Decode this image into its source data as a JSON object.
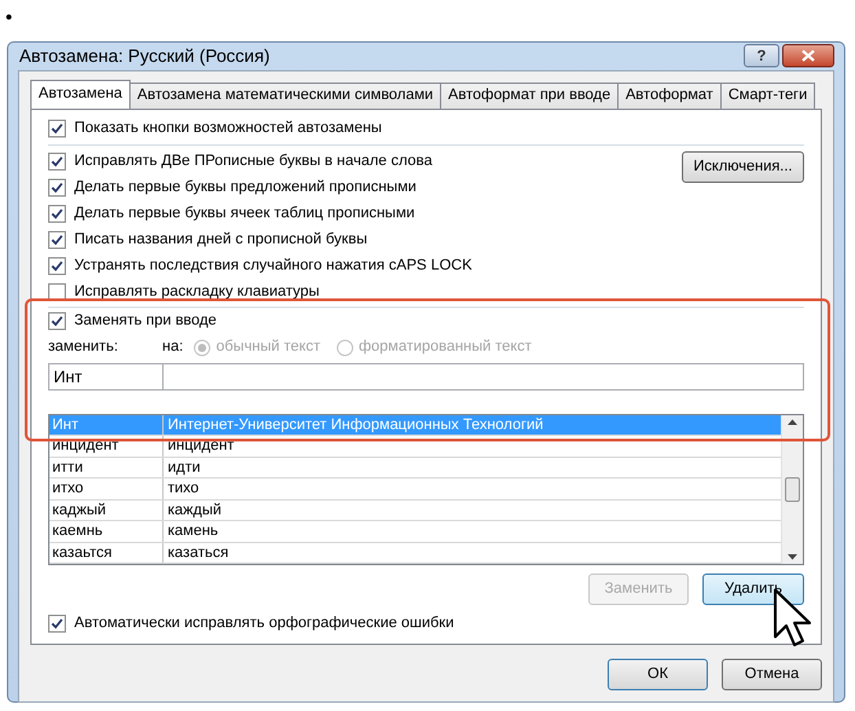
{
  "bullet": "•",
  "window": {
    "title": "Автозамена: Русский (Россия)",
    "help": "?"
  },
  "tabs": [
    {
      "label": "Автозамена",
      "selected": true
    },
    {
      "label": "Автозамена математическими символами",
      "selected": false
    },
    {
      "label": "Автоформат при вводе",
      "selected": false
    },
    {
      "label": "Автоформат",
      "selected": false
    },
    {
      "label": "Смарт-теги",
      "selected": false
    }
  ],
  "show_buttons": {
    "label": "Показать кнопки возможностей автозамены",
    "checked": true
  },
  "options": [
    {
      "label": "Исправлять ДВе ПРописные буквы в начале слова",
      "checked": true
    },
    {
      "label": "Делать первые буквы предложений прописными",
      "checked": true
    },
    {
      "label": "Делать первые буквы ячеек таблиц прописными",
      "checked": true
    },
    {
      "label": "Писать названия дней с прописной буквы",
      "checked": true
    },
    {
      "label": "Устранять последствия случайного нажатия cAPS LOCK",
      "checked": true
    },
    {
      "label": "Исправлять раскладку клавиатуры",
      "checked": false
    }
  ],
  "exceptions_button": "Исключения...",
  "replace_as_typed": {
    "label": "Заменять при вводе",
    "checked": true
  },
  "replace_label": "заменить:",
  "with_label": "на:",
  "format_options": [
    {
      "label": "обычный текст",
      "selected": true,
      "disabled": true
    },
    {
      "label": "форматированный текст",
      "selected": false,
      "disabled": true
    }
  ],
  "replace_field": {
    "value": "Инт"
  },
  "entries": [
    {
      "from": "Инт",
      "to": "Интернет-Университет Информационных Технологий",
      "selected": true
    },
    {
      "from": "инцидент",
      "to": "инцидент",
      "selected": false
    },
    {
      "from": "итти",
      "to": "идти",
      "selected": false
    },
    {
      "from": "итхо",
      "to": "тихо",
      "selected": false
    },
    {
      "from": "каджый",
      "to": "каждый",
      "selected": false
    },
    {
      "from": "каемнь",
      "to": "камень",
      "selected": false
    },
    {
      "from": "казаьтся",
      "to": "казаться",
      "selected": false
    }
  ],
  "replace_button": {
    "label": "Заменить",
    "disabled": true
  },
  "delete_button": {
    "label": "Удалить"
  },
  "spelling": {
    "label": "Автоматически исправлять орфографические ошибки",
    "checked": true
  },
  "ok_button": "ОК",
  "cancel_button": "Отмена"
}
